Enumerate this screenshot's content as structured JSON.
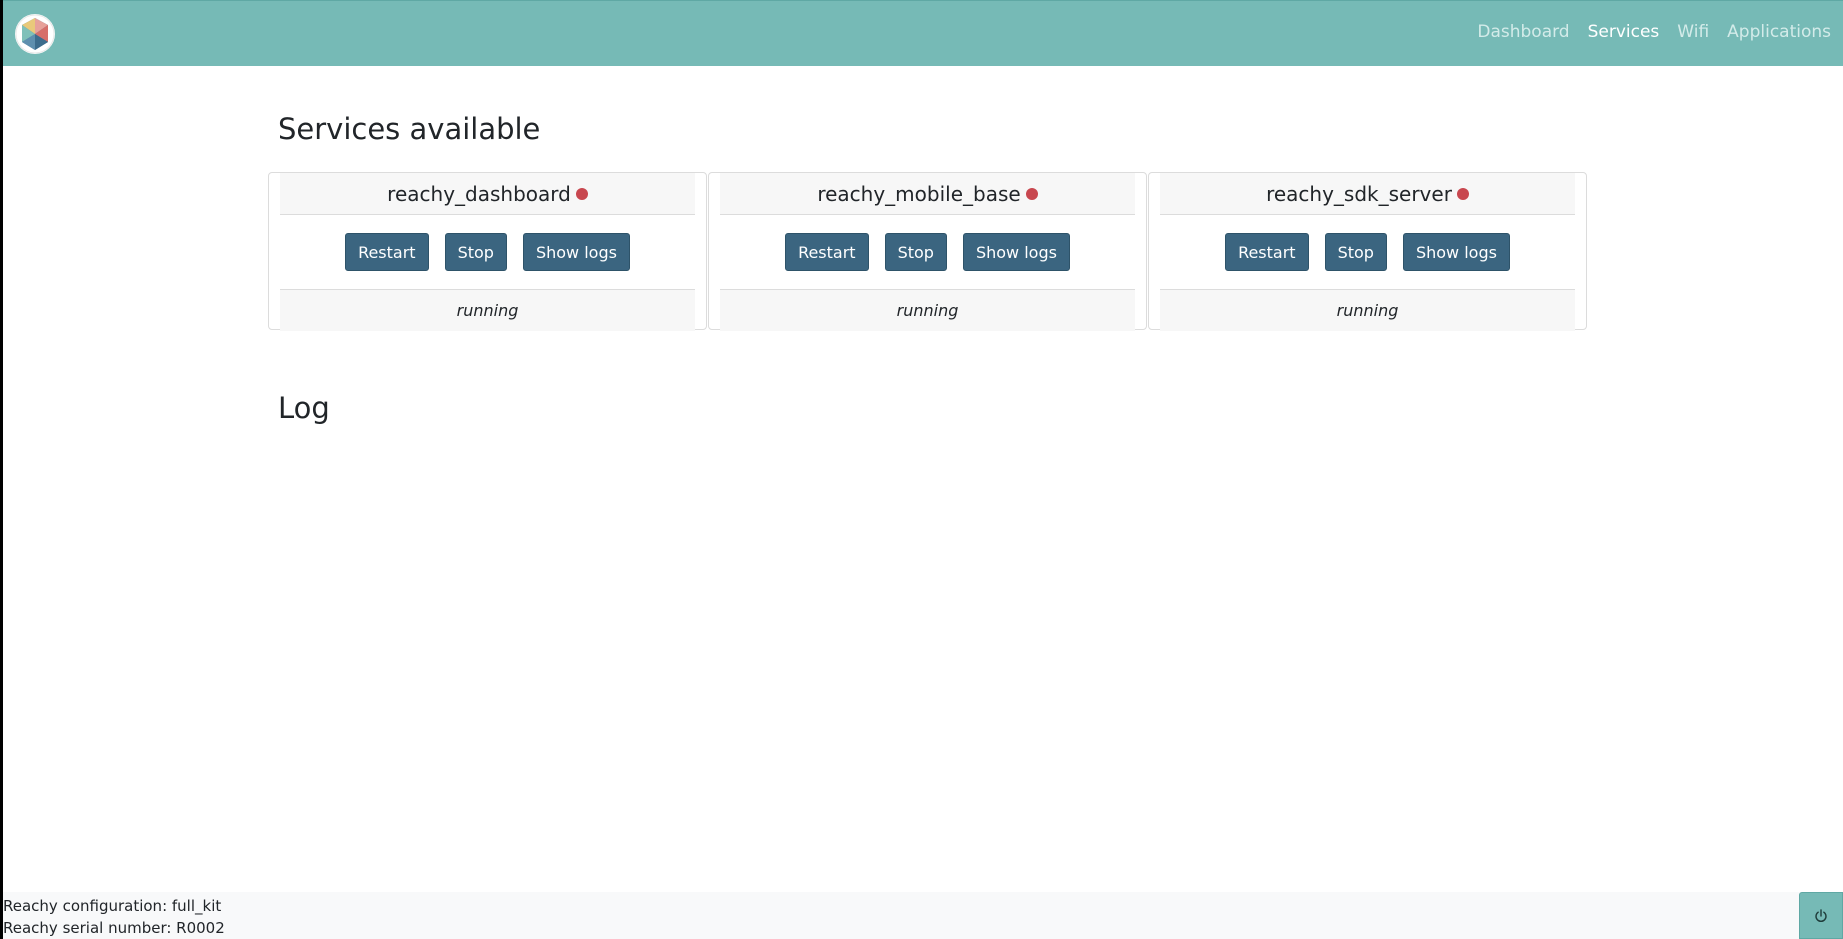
{
  "nav": {
    "logo_icon": "reachy-logo-icon",
    "links": [
      {
        "label": "Dashboard",
        "active": false
      },
      {
        "label": "Services",
        "active": true
      },
      {
        "label": "Wifi",
        "active": false
      },
      {
        "label": "Applications",
        "active": false
      }
    ]
  },
  "services": {
    "title": "Services available",
    "items": [
      {
        "name": "reachy_dashboard",
        "restart_label": "Restart",
        "stop_label": "Stop",
        "logs_label": "Show logs",
        "status": "running",
        "indicator_color": "#c8474f"
      },
      {
        "name": "reachy_mobile_base",
        "restart_label": "Restart",
        "stop_label": "Stop",
        "logs_label": "Show logs",
        "status": "running",
        "indicator_color": "#c8474f"
      },
      {
        "name": "reachy_sdk_server",
        "restart_label": "Restart",
        "stop_label": "Stop",
        "logs_label": "Show logs",
        "status": "running",
        "indicator_color": "#c8474f"
      }
    ]
  },
  "log": {
    "title": "Log"
  },
  "footer": {
    "configuration": "Reachy configuration: full_kit",
    "serial": "Reachy serial number: R0002",
    "power_icon": "power-icon"
  },
  "colors": {
    "navbar": "#76bab6",
    "button": "#3b6580",
    "status_indicator": "#c8474f"
  }
}
